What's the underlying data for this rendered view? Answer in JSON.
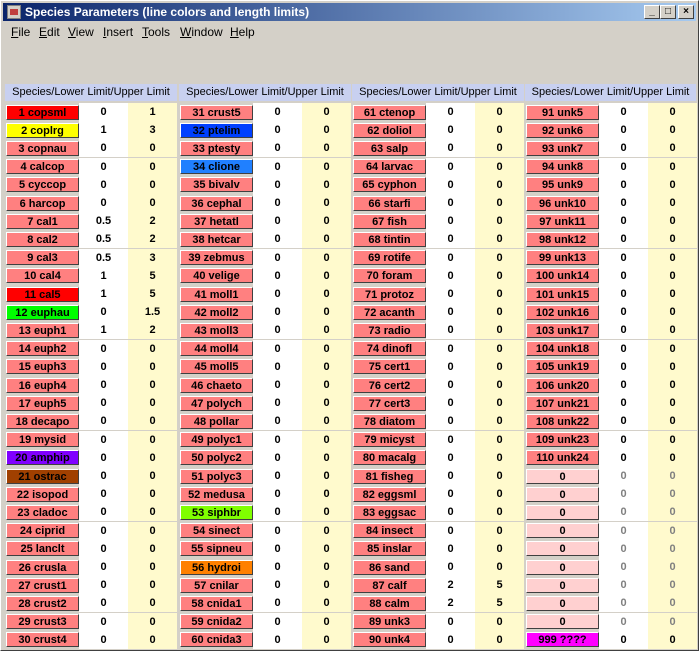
{
  "window": {
    "title": "Species Parameters (line colors and length limits)",
    "minimize_label": "_",
    "maximize_label": "□",
    "close_label": "×"
  },
  "menu": [
    {
      "label": "File",
      "key": "F"
    },
    {
      "label": "Edit",
      "key": "E"
    },
    {
      "label": "View",
      "key": "V"
    },
    {
      "label": "Insert",
      "key": "I"
    },
    {
      "label": "Tools",
      "key": "T"
    },
    {
      "label": "Window",
      "key": "W"
    },
    {
      "label": "Help",
      "key": "H"
    }
  ],
  "header_label": "Species/Lower Limit/Upper Limit",
  "colors": {
    "default_name_bg": "#ff8080",
    "empty_name_bg": "#ffd0d0",
    "lower_bg": "#ffffff",
    "upper_bg": "#fffacd",
    "header_bg": "#c8d0f0"
  },
  "columns": [
    [
      {
        "name": "1 copsml",
        "lo": "0",
        "hi": "1",
        "color": "#ff0000"
      },
      {
        "name": "2 coplrg",
        "lo": "1",
        "hi": "3",
        "color": "#ffff00"
      },
      {
        "name": "3 copnau",
        "lo": "0",
        "hi": "0"
      },
      {
        "name": "4 calcop",
        "lo": "0",
        "hi": "0"
      },
      {
        "name": "5 cyccop",
        "lo": "0",
        "hi": "0"
      },
      {
        "name": "6 harcop",
        "lo": "0",
        "hi": "0"
      },
      {
        "name": "7 cal1",
        "lo": "0.5",
        "hi": "2"
      },
      {
        "name": "8 cal2",
        "lo": "0.5",
        "hi": "2"
      },
      {
        "name": "9 cal3",
        "lo": "0.5",
        "hi": "3"
      },
      {
        "name": "10 cal4",
        "lo": "1",
        "hi": "5"
      },
      {
        "name": "11 cal5",
        "lo": "1",
        "hi": "5",
        "color": "#ff0000"
      },
      {
        "name": "12 euphau",
        "lo": "0",
        "hi": "1.5",
        "color": "#00ff00"
      },
      {
        "name": "13 euph1",
        "lo": "1",
        "hi": "2"
      },
      {
        "name": "14 euph2",
        "lo": "0",
        "hi": "0"
      },
      {
        "name": "15 euph3",
        "lo": "0",
        "hi": "0"
      },
      {
        "name": "16 euph4",
        "lo": "0",
        "hi": "0"
      },
      {
        "name": "17 euph5",
        "lo": "0",
        "hi": "0"
      },
      {
        "name": "18 decapo",
        "lo": "0",
        "hi": "0"
      },
      {
        "name": "19 mysid",
        "lo": "0",
        "hi": "0"
      },
      {
        "name": "20 amphip",
        "lo": "0",
        "hi": "0",
        "color": "#8000ff"
      },
      {
        "name": "21 ostrac",
        "lo": "0",
        "hi": "0",
        "color": "#a04000"
      },
      {
        "name": "22 isopod",
        "lo": "0",
        "hi": "0"
      },
      {
        "name": "23 cladoc",
        "lo": "0",
        "hi": "0"
      },
      {
        "name": "24 ciprid",
        "lo": "0",
        "hi": "0"
      },
      {
        "name": "25 lanclt",
        "lo": "0",
        "hi": "0"
      },
      {
        "name": "26 crusla",
        "lo": "0",
        "hi": "0"
      },
      {
        "name": "27 crust1",
        "lo": "0",
        "hi": "0"
      },
      {
        "name": "28 crust2",
        "lo": "0",
        "hi": "0"
      },
      {
        "name": "29 crust3",
        "lo": "0",
        "hi": "0"
      },
      {
        "name": "30 crust4",
        "lo": "0",
        "hi": "0"
      }
    ],
    [
      {
        "name": "31 crust5",
        "lo": "0",
        "hi": "0"
      },
      {
        "name": "32 ptelim",
        "lo": "0",
        "hi": "0",
        "color": "#0040ff"
      },
      {
        "name": "33 ptesty",
        "lo": "0",
        "hi": "0"
      },
      {
        "name": "34 clione",
        "lo": "0",
        "hi": "0",
        "color": "#2080ff"
      },
      {
        "name": "35 bivalv",
        "lo": "0",
        "hi": "0"
      },
      {
        "name": "36 cephal",
        "lo": "0",
        "hi": "0"
      },
      {
        "name": "37 hetatl",
        "lo": "0",
        "hi": "0"
      },
      {
        "name": "38 hetcar",
        "lo": "0",
        "hi": "0"
      },
      {
        "name": "39 zebmus",
        "lo": "0",
        "hi": "0"
      },
      {
        "name": "40 velige",
        "lo": "0",
        "hi": "0"
      },
      {
        "name": "41 moll1",
        "lo": "0",
        "hi": "0"
      },
      {
        "name": "42 moll2",
        "lo": "0",
        "hi": "0"
      },
      {
        "name": "43 moll3",
        "lo": "0",
        "hi": "0"
      },
      {
        "name": "44 moll4",
        "lo": "0",
        "hi": "0"
      },
      {
        "name": "45 moll5",
        "lo": "0",
        "hi": "0"
      },
      {
        "name": "46 chaeto",
        "lo": "0",
        "hi": "0"
      },
      {
        "name": "47 polych",
        "lo": "0",
        "hi": "0"
      },
      {
        "name": "48 pollar",
        "lo": "0",
        "hi": "0"
      },
      {
        "name": "49 polyc1",
        "lo": "0",
        "hi": "0"
      },
      {
        "name": "50 polyc2",
        "lo": "0",
        "hi": "0"
      },
      {
        "name": "51 polyc3",
        "lo": "0",
        "hi": "0"
      },
      {
        "name": "52 medusa",
        "lo": "0",
        "hi": "0"
      },
      {
        "name": "53 siphbr",
        "lo": "0",
        "hi": "0",
        "color": "#80ff00"
      },
      {
        "name": "54 sinect",
        "lo": "0",
        "hi": "0"
      },
      {
        "name": "55 sipneu",
        "lo": "0",
        "hi": "0"
      },
      {
        "name": "56 hydroi",
        "lo": "0",
        "hi": "0",
        "color": "#ff8000"
      },
      {
        "name": "57 cnilar",
        "lo": "0",
        "hi": "0"
      },
      {
        "name": "58 cnida1",
        "lo": "0",
        "hi": "0"
      },
      {
        "name": "59 cnida2",
        "lo": "0",
        "hi": "0"
      },
      {
        "name": "60 cnida3",
        "lo": "0",
        "hi": "0"
      }
    ],
    [
      {
        "name": "61 ctenop",
        "lo": "0",
        "hi": "0"
      },
      {
        "name": "62 doliol",
        "lo": "0",
        "hi": "0"
      },
      {
        "name": "63 salp",
        "lo": "0",
        "hi": "0"
      },
      {
        "name": "64 larvac",
        "lo": "0",
        "hi": "0"
      },
      {
        "name": "65 cyphon",
        "lo": "0",
        "hi": "0"
      },
      {
        "name": "66 starfi",
        "lo": "0",
        "hi": "0"
      },
      {
        "name": "67 fish",
        "lo": "0",
        "hi": "0"
      },
      {
        "name": "68 tintin",
        "lo": "0",
        "hi": "0"
      },
      {
        "name": "69 rotife",
        "lo": "0",
        "hi": "0"
      },
      {
        "name": "70 foram",
        "lo": "0",
        "hi": "0"
      },
      {
        "name": "71 protoz",
        "lo": "0",
        "hi": "0"
      },
      {
        "name": "72 acanth",
        "lo": "0",
        "hi": "0"
      },
      {
        "name": "73 radio",
        "lo": "0",
        "hi": "0"
      },
      {
        "name": "74 dinofl",
        "lo": "0",
        "hi": "0"
      },
      {
        "name": "75 cert1",
        "lo": "0",
        "hi": "0"
      },
      {
        "name": "76 cert2",
        "lo": "0",
        "hi": "0"
      },
      {
        "name": "77 cert3",
        "lo": "0",
        "hi": "0"
      },
      {
        "name": "78 diatom",
        "lo": "0",
        "hi": "0"
      },
      {
        "name": "79 micyst",
        "lo": "0",
        "hi": "0"
      },
      {
        "name": "80 macalg",
        "lo": "0",
        "hi": "0"
      },
      {
        "name": "81 fisheg",
        "lo": "0",
        "hi": "0"
      },
      {
        "name": "82 eggsml",
        "lo": "0",
        "hi": "0"
      },
      {
        "name": "83 eggsac",
        "lo": "0",
        "hi": "0"
      },
      {
        "name": "84 insect",
        "lo": "0",
        "hi": "0"
      },
      {
        "name": "85 inslar",
        "lo": "0",
        "hi": "0"
      },
      {
        "name": "86 sand",
        "lo": "0",
        "hi": "0"
      },
      {
        "name": "87 calf",
        "lo": "2",
        "hi": "5"
      },
      {
        "name": "88 calm",
        "lo": "2",
        "hi": "5"
      },
      {
        "name": "89 unk3",
        "lo": "0",
        "hi": "0"
      },
      {
        "name": "90 unk4",
        "lo": "0",
        "hi": "0"
      }
    ],
    [
      {
        "name": "91 unk5",
        "lo": "0",
        "hi": "0"
      },
      {
        "name": "92 unk6",
        "lo": "0",
        "hi": "0"
      },
      {
        "name": "93 unk7",
        "lo": "0",
        "hi": "0"
      },
      {
        "name": "94 unk8",
        "lo": "0",
        "hi": "0"
      },
      {
        "name": "95 unk9",
        "lo": "0",
        "hi": "0"
      },
      {
        "name": "96 unk10",
        "lo": "0",
        "hi": "0"
      },
      {
        "name": "97 unk11",
        "lo": "0",
        "hi": "0"
      },
      {
        "name": "98 unk12",
        "lo": "0",
        "hi": "0"
      },
      {
        "name": "99 unk13",
        "lo": "0",
        "hi": "0"
      },
      {
        "name": "100 unk14",
        "lo": "0",
        "hi": "0"
      },
      {
        "name": "101 unk15",
        "lo": "0",
        "hi": "0"
      },
      {
        "name": "102 unk16",
        "lo": "0",
        "hi": "0"
      },
      {
        "name": "103 unk17",
        "lo": "0",
        "hi": "0"
      },
      {
        "name": "104 unk18",
        "lo": "0",
        "hi": "0"
      },
      {
        "name": "105 unk19",
        "lo": "0",
        "hi": "0"
      },
      {
        "name": "106 unk20",
        "lo": "0",
        "hi": "0"
      },
      {
        "name": "107 unk21",
        "lo": "0",
        "hi": "0"
      },
      {
        "name": "108 unk22",
        "lo": "0",
        "hi": "0"
      },
      {
        "name": "109 unk23",
        "lo": "0",
        "hi": "0"
      },
      {
        "name": "110 unk24",
        "lo": "0",
        "hi": "0"
      },
      {
        "name": "0",
        "lo": "0",
        "hi": "0",
        "empty": true
      },
      {
        "name": "0",
        "lo": "0",
        "hi": "0",
        "empty": true
      },
      {
        "name": "0",
        "lo": "0",
        "hi": "0",
        "empty": true
      },
      {
        "name": "0",
        "lo": "0",
        "hi": "0",
        "empty": true
      },
      {
        "name": "0",
        "lo": "0",
        "hi": "0",
        "empty": true
      },
      {
        "name": "0",
        "lo": "0",
        "hi": "0",
        "empty": true
      },
      {
        "name": "0",
        "lo": "0",
        "hi": "0",
        "empty": true
      },
      {
        "name": "0",
        "lo": "0",
        "hi": "0",
        "empty": true
      },
      {
        "name": "0",
        "lo": "0",
        "hi": "0",
        "empty": true
      },
      {
        "name": "999 ????",
        "lo": "0",
        "hi": "0",
        "color": "#ff00ff"
      }
    ]
  ]
}
